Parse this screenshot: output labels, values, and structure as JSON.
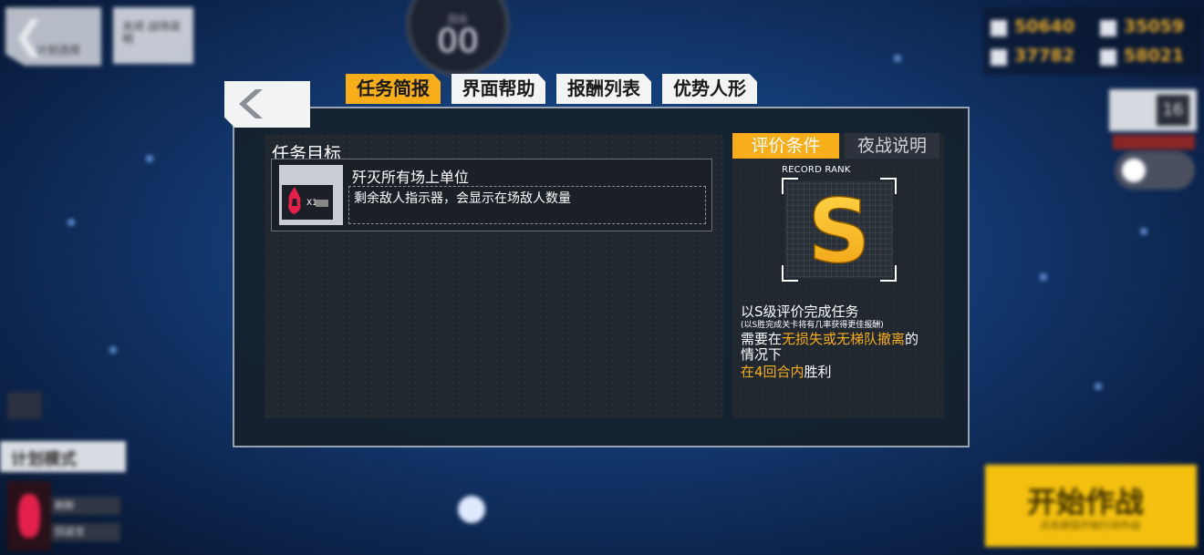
{
  "background": {
    "back_label": "计划选择",
    "btn2_label": "关闭 战场说明",
    "turn_label": "回合",
    "turn_number": "00",
    "resources": [
      "50640",
      "35059",
      "37782",
      "58021"
    ],
    "side_box_value": "16",
    "plan_mode_label": "计划模式",
    "tag1": "刷新",
    "tag2": "回退至",
    "start_button": {
      "label": "开始作战",
      "sub": "点击按钮开始行动作战"
    }
  },
  "dialog": {
    "tabs": [
      "任务简报",
      "界面帮助",
      "报酬列表",
      "优势人形"
    ],
    "active_tab": 0,
    "objective": {
      "title": "任务目标",
      "name": "歼灭所有场上单位",
      "description": "剩余敌人指示器，会显示在场敌人数量",
      "icon_count": "X1",
      "icon": "enemy-fox-icon"
    },
    "right_tabs": [
      "评价条件",
      "夜战说明"
    ],
    "rank": {
      "label": "RECORD RANK",
      "grade": "S"
    },
    "conditions": {
      "line1": "以S级评价完成任务",
      "line1_sub": "(以S胜完成关卡将有几率获得更佳报酬)",
      "line2_pre": "需要在",
      "line2_hl": "无损失或无梯队撤离",
      "line2_post": "的",
      "line2_wrap": "情况下",
      "line3_hl": "在4回合内",
      "line3_post": "胜利"
    }
  },
  "colors": {
    "accent": "#f8ad1b",
    "hostile": "#e2204a"
  }
}
